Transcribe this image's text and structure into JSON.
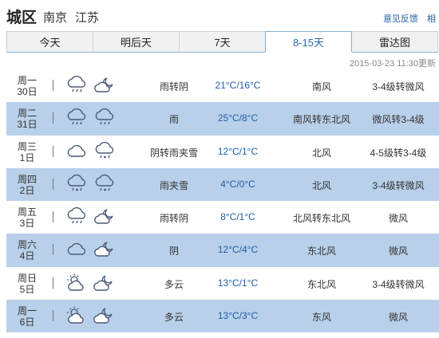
{
  "header": {
    "title": "城区",
    "city": "南京",
    "province": "江苏",
    "feedback_link": "意见反馈",
    "extra_link": "相"
  },
  "tabs": [
    {
      "label": "今天",
      "active": false
    },
    {
      "label": "明后天",
      "active": false
    },
    {
      "label": "7天",
      "active": false
    },
    {
      "label": "8-15天",
      "active": true
    },
    {
      "label": "雷达图",
      "active": false
    }
  ],
  "updated": "2015-03-23 11:30更新",
  "forecast": [
    {
      "weekday": "周一",
      "date": "30日",
      "condition": "雨转阴",
      "temp": "21°C/16°C",
      "wind_dir": "南风",
      "wind_level": "3-4级转微风",
      "icon_day": "rain-cloud-icon",
      "icon_night": "cloud-moon-icon"
    },
    {
      "weekday": "周二",
      "date": "31日",
      "condition": "雨",
      "temp": "25°C/8°C",
      "wind_dir": "南风转东北风",
      "wind_level": "微风转3-4级",
      "icon_day": "rain-cloud-icon",
      "icon_night": "rain-cloud-icon"
    },
    {
      "weekday": "周三",
      "date": "1日",
      "condition": "阴转雨夹雪",
      "temp": "12°C/1°C",
      "wind_dir": "北风",
      "wind_level": "4-5级转3-4级",
      "icon_day": "cloud-icon",
      "icon_night": "sleet-cloud-icon"
    },
    {
      "weekday": "周四",
      "date": "2日",
      "condition": "雨夹雪",
      "temp": "4°C/0°C",
      "wind_dir": "北风",
      "wind_level": "3-4级转微风",
      "icon_day": "sleet-cloud-icon",
      "icon_night": "sleet-cloud-icon"
    },
    {
      "weekday": "周五",
      "date": "3日",
      "condition": "雨转阴",
      "temp": "8°C/1°C",
      "wind_dir": "北风转东北风",
      "wind_level": "微风",
      "icon_day": "rain-cloud-icon",
      "icon_night": "cloud-moon-icon"
    },
    {
      "weekday": "周六",
      "date": "4日",
      "condition": "阴",
      "temp": "12°C/4°C",
      "wind_dir": "东北风",
      "wind_level": "微风",
      "icon_day": "cloud-icon",
      "icon_night": "cloud-moon-icon"
    },
    {
      "weekday": "周日",
      "date": "5日",
      "condition": "多云",
      "temp": "13°C/1°C",
      "wind_dir": "东北风",
      "wind_level": "3-4级转微风",
      "icon_day": "sun-cloud-icon",
      "icon_night": "moon-cloud-icon"
    },
    {
      "weekday": "周一",
      "date": "6日",
      "condition": "多云",
      "temp": "13°C/3°C",
      "wind_dir": "东风",
      "wind_level": "微风",
      "icon_day": "sun-cloud-icon",
      "icon_night": "moon-cloud-icon"
    }
  ],
  "colors": {
    "accent_blue": "#1f5fa6",
    "row_highlight": "#b9d0ea",
    "icon_stroke": "#4a5a73"
  }
}
